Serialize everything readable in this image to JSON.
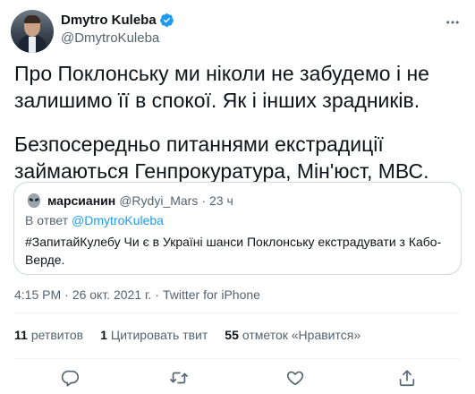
{
  "author": {
    "display_name": "Dmytro Kuleba",
    "handle": "@DmytroKuleba",
    "verified_color": "#1d9bf0"
  },
  "tweet": {
    "paragraphs": [
      "Про Поклонську ми ніколи не забудемо і не залишимо її в спокої. Як і інших зрадників.",
      "Безпосередньо питаннями екстрадиції займаються Генпрокуратура, Мін'юст, МВС."
    ]
  },
  "quote": {
    "avatar_icon": "alien-icon",
    "name": "марсианин",
    "handle": "@Rydyi_Mars",
    "separator": "·",
    "time": "23 ч",
    "reply_prefix": "В ответ",
    "reply_mention": "@DmytroKuleba",
    "text": "#ЗапитайКулебу Чи є в Україні шанси Поклонську екстрадувати з Кабо-Верде."
  },
  "meta": {
    "time": "4:15 PM",
    "separator": "·",
    "date": "26 окт. 2021 г.",
    "source": "Twitter for iPhone"
  },
  "stats": {
    "retweets_count": "11",
    "retweets_label": "ретвитов",
    "quotes_count": "1",
    "quotes_label": "Цитировать твит",
    "likes_count": "55",
    "likes_label": "отметок «Нравится»"
  },
  "actions": [
    "reply-icon",
    "retweet-icon",
    "like-icon",
    "share-icon"
  ],
  "colors": {
    "text": "#0f1419",
    "secondary": "#536471",
    "link": "#1d9bf0",
    "border": "#cfd9de"
  }
}
